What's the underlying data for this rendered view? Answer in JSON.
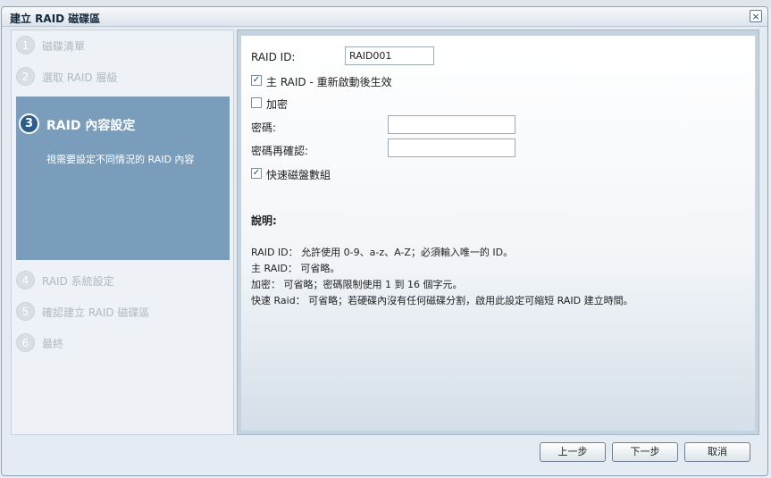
{
  "window": {
    "title": "建立 RAID 磁碟區",
    "close_symbol": "×"
  },
  "steps": [
    {
      "number": "1",
      "label": "磁碟清單"
    },
    {
      "number": "2",
      "label": "選取 RAID 層級"
    },
    {
      "number": "3",
      "label": "RAID 內容設定",
      "description": "視需要設定不同情況的 RAID 內容"
    },
    {
      "number": "4",
      "label": "RAID 系統設定"
    },
    {
      "number": "5",
      "label": "確認建立 RAID 磁碟區"
    },
    {
      "number": "6",
      "label": "最終"
    }
  ],
  "form": {
    "raid_id_label": "RAID ID:",
    "raid_id_value": "RAID001",
    "master_raid_label": "主 RAID - 重新啟動後生效",
    "master_raid_checked": true,
    "encrypt_label": "加密",
    "encrypt_checked": false,
    "password_label": "密碼:",
    "password_value": "",
    "confirm_label": "密碼再確認:",
    "confirm_value": "",
    "quick_raid_label": "快速磁盤數組",
    "quick_raid_checked": true
  },
  "notes": {
    "title": "說明:",
    "lines": [
      "RAID ID： 允許使用 0-9、a-z、A-Z；必須輸入唯一的 ID。",
      "主 RAID： 可省略。",
      "加密： 可省略；密碼限制使用 1 到 16 個字元。",
      "快速 Raid： 可省略；若硬碟內沒有任何磁碟分割，啟用此設定可縮短 RAID 建立時間。"
    ]
  },
  "buttons": {
    "prev": "上一步",
    "next": "下一步",
    "cancel": "取消"
  },
  "icons": {
    "check": "✓",
    "close": "close-icon"
  },
  "colors": {
    "active_step_bg": "#7a9dbb",
    "active_step_num": "#2e5d8c"
  }
}
